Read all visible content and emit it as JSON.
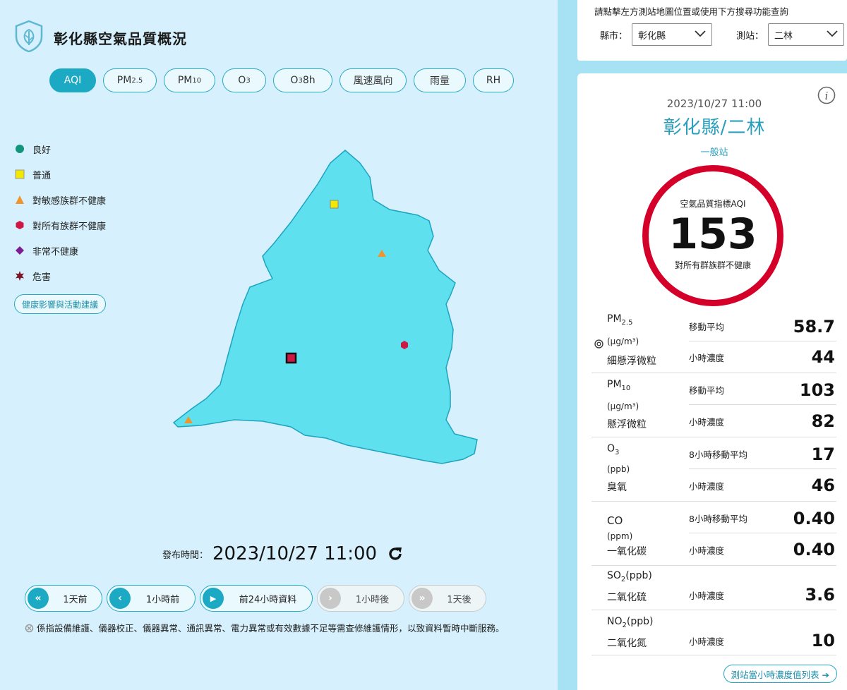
{
  "header": {
    "title": "彰化縣空氣品質概況",
    "logo_icon": "leaf-shield-icon"
  },
  "tabs": [
    {
      "label": "AQI",
      "sub": "",
      "active": true
    },
    {
      "label": "PM",
      "sub": "2.5",
      "active": false
    },
    {
      "label": "PM",
      "sub": "10",
      "active": false
    },
    {
      "label": "O",
      "sub": "3",
      "active": false
    },
    {
      "label": "O",
      "sub": "3",
      "suffix": " 8h",
      "active": false
    },
    {
      "label": "風速風向",
      "sub": "",
      "active": false
    },
    {
      "label": "雨量",
      "sub": "",
      "active": false
    },
    {
      "label": "RH",
      "sub": "",
      "active": false
    }
  ],
  "legend": [
    {
      "label": "良好",
      "shape": "circle",
      "color": "#12957a"
    },
    {
      "label": "普通",
      "shape": "square",
      "color": "#f2e800"
    },
    {
      "label": "對敏感族群不健康",
      "shape": "triangle",
      "color": "#f0952e"
    },
    {
      "label": "對所有族群不健康",
      "shape": "hexagon",
      "color": "#cf1744"
    },
    {
      "label": "非常不健康",
      "shape": "diamond",
      "color": "#7d1c95"
    },
    {
      "label": "危害",
      "shape": "star",
      "color": "#7a1525"
    }
  ],
  "advice_button": "健康影響與活動建議",
  "map": {
    "region_color": "#5ee0ef",
    "border_color": "#1ea3c0"
  },
  "publish": {
    "label": "發布時間：",
    "value": "2023/10/27 11:00",
    "refresh_icon": "refresh-icon"
  },
  "nav": [
    {
      "label": "1天前",
      "icon": "double-chevron-left-icon",
      "glyph": "«",
      "enabled": true
    },
    {
      "label": "1小時前",
      "icon": "chevron-left-icon",
      "glyph": "‹",
      "enabled": true
    },
    {
      "label": "前24小時資料",
      "icon": "play-icon",
      "glyph": "▶",
      "enabled": true
    },
    {
      "label": "1小時後",
      "icon": "chevron-right-icon",
      "glyph": "›",
      "enabled": false
    },
    {
      "label": "1天後",
      "icon": "double-chevron-right-icon",
      "glyph": "»",
      "enabled": false
    }
  ],
  "note": "係指設備維護、儀器校正、儀器異常、通訊異常、電力異常或有效數據不足等需查修維護情形，以致資料暫時中斷服務。",
  "search": {
    "hint": "請點擊左方測站地圖位置或使用下方搜尋功能查詢",
    "county_label": "縣市：",
    "county_value": "彰化縣",
    "station_label": "測站：",
    "station_value": "二林"
  },
  "card": {
    "time": "2023/10/27 11:00",
    "station": "彰化縣/二林",
    "type": "一般站",
    "aqi_title": "空氣品質指標AQI",
    "aqi_value": "153",
    "aqi_status": "對所有群族群不健康",
    "aqi_color": "#d4002a",
    "list_button": "測站當小時濃度值列表 ➔"
  },
  "pollutants": [
    {
      "name": "PM",
      "sub": "2.5",
      "unit": "(μg/m³)",
      "zh": "細懸浮微粒",
      "target": true,
      "rows": [
        {
          "kind": "移動平均",
          "value": "58.7"
        },
        {
          "kind": "小時濃度",
          "value": "44"
        }
      ]
    },
    {
      "name": "PM",
      "sub": "10",
      "unit": "(μg/m³)",
      "zh": "懸浮微粒",
      "rows": [
        {
          "kind": "移動平均",
          "value": "103"
        },
        {
          "kind": "小時濃度",
          "value": "82"
        }
      ]
    },
    {
      "name": "O",
      "sub": "3",
      "unit": "(ppb)",
      "zh": "臭氧",
      "rows": [
        {
          "kind": "8小時移動平均",
          "value": "17"
        },
        {
          "kind": "小時濃度",
          "value": "46"
        }
      ]
    },
    {
      "name": "CO",
      "sub": "",
      "unit": "(ppm)",
      "zh": "一氧化碳",
      "rows": [
        {
          "kind": "8小時移動平均",
          "value": "0.40"
        },
        {
          "kind": "小時濃度",
          "value": "0.40"
        }
      ]
    },
    {
      "name": "SO",
      "sub": "2",
      "unit": "(ppb)",
      "zh": "二氧化硫",
      "rows": [
        {
          "kind": "小時濃度",
          "value": "3.6"
        }
      ]
    },
    {
      "name": "NO",
      "sub": "2",
      "unit": "(ppb)",
      "zh": "二氧化氮",
      "rows": [
        {
          "kind": "小時濃度",
          "value": "10"
        }
      ]
    }
  ]
}
